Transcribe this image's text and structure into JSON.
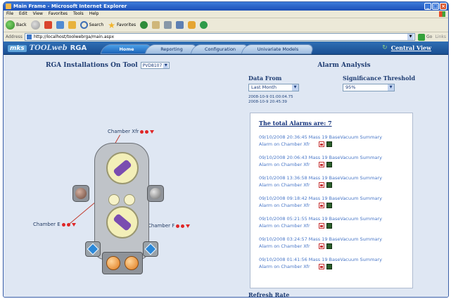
{
  "window": {
    "title": "Main Frame - Microsoft Internet Explorer",
    "controls": [
      "_",
      "□",
      "×"
    ]
  },
  "menu": [
    "File",
    "Edit",
    "View",
    "Favorites",
    "Tools",
    "Help"
  ],
  "toolbar": {
    "back_label": "Back",
    "search_label": "Search",
    "favorites_label": "Favorites"
  },
  "address": {
    "label": "Address",
    "url": "http://localhost/toolwebrga/main.aspx",
    "go_label": "Go",
    "links_label": "Links"
  },
  "app": {
    "logo_mks": "mks",
    "logo_toolweb": "TOOLweb",
    "logo_rga": "RGA",
    "tabs": [
      {
        "label": "Home",
        "active": true
      },
      {
        "label": "Reporting",
        "active": false
      },
      {
        "label": "Configuration",
        "active": false
      },
      {
        "label": "Univariate Models",
        "active": false
      }
    ],
    "central_view": "Central View"
  },
  "left": {
    "title": "RGA Installations On Tool",
    "tool_value": "PVD8107",
    "chamber_labels": {
      "xfr": "Chamber Xfr",
      "e": "Chamber E",
      "f": "Chamber F"
    }
  },
  "alarm": {
    "title": "Alarm Analysis",
    "data_from_label": "Data From",
    "data_from_value": "Last Month",
    "significance_label": "Significance Threshold",
    "significance_value": "95%",
    "range_line1": "2008-10-9 01:00:04.75",
    "range_line2": "2008-10-9 20:45:39",
    "total_label": "The total Alarms are:  7",
    "items": [
      {
        "line1": "09/10/2008 20:36:45 Mass 19 BaseVacuum Summary",
        "line2": "Alarm on Chamber Xfr"
      },
      {
        "line1": "09/10/2008 20:06:43 Mass 19 BaseVacuum Summary",
        "line2": "Alarm on Chamber Xfr"
      },
      {
        "line1": "09/10/2008 13:36:58 Mass 19 BaseVacuum Summary",
        "line2": "Alarm on Chamber Xfr"
      },
      {
        "line1": "09/10/2008 09:18:42 Mass 19 BaseVacuum Summary",
        "line2": "Alarm on Chamber Xfr"
      },
      {
        "line1": "09/10/2008 05:21:55 Mass 19 BaseVacuum Summary",
        "line2": "Alarm on Chamber Xfr"
      },
      {
        "line1": "09/10/2008 03:24:57 Mass 19 BaseVacuum Summary",
        "line2": "Alarm on Chamber Xfr"
      },
      {
        "line1": "09/10/2008 01:41:56 Mass 19 BaseVacuum Summary",
        "line2": "Alarm on Chamber Xfr"
      }
    ],
    "refresh_label": "Refresh Rate"
  },
  "colors": {
    "header_blue": "#1a4f92",
    "alarm_link": "#4a78c8",
    "alarm_red": "#e02626",
    "panel_bg": "#dfe7f3"
  }
}
